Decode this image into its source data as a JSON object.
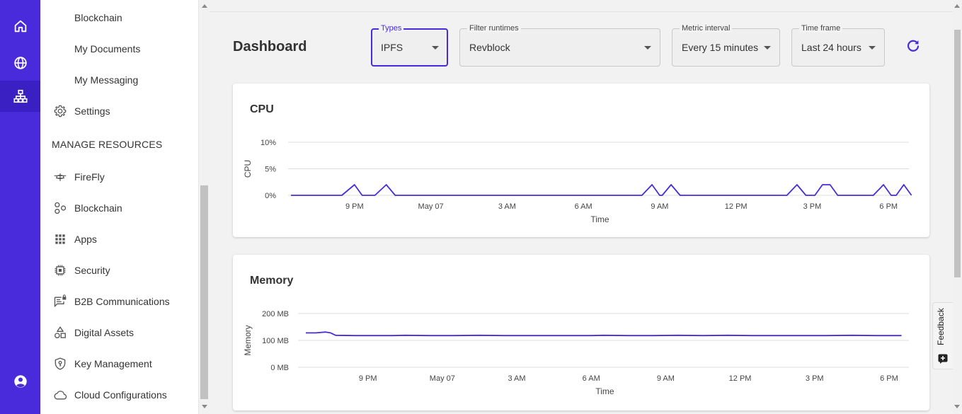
{
  "rail": {
    "items": [
      {
        "icon": "home-icon"
      },
      {
        "icon": "globe-icon"
      },
      {
        "icon": "network-icon"
      }
    ],
    "bottom_icon": "account-icon",
    "colors": {
      "bg": "#4a2bdc",
      "active": "#3a1fc2"
    }
  },
  "sidebar": {
    "sub_items": [
      {
        "label": "Blockchain"
      },
      {
        "label": "My Documents"
      },
      {
        "label": "My Messaging"
      }
    ],
    "settings_label": "Settings",
    "section_heading": "MANAGE RESOURCES",
    "resources": [
      {
        "label": "FireFly",
        "icon": "firefly-icon"
      },
      {
        "label": "Blockchain",
        "icon": "blockchain-icon"
      },
      {
        "label": "Apps",
        "icon": "apps-grid-icon"
      },
      {
        "label": "Security",
        "icon": "chip-icon"
      },
      {
        "label": "B2B Communications",
        "icon": "message-lock-icon"
      },
      {
        "label": "Digital Assets",
        "icon": "shapes-icon"
      },
      {
        "label": "Key Management",
        "icon": "shield-key-icon"
      },
      {
        "label": "Cloud Configurations",
        "icon": "cloud-icon"
      }
    ]
  },
  "header": {
    "title": "Dashboard",
    "filters": {
      "types": {
        "label": "Types",
        "value": "IPFS"
      },
      "runtimes": {
        "label": "Filter runtimes",
        "value": "Revblock"
      },
      "interval": {
        "label": "Metric interval",
        "value": "Every 15 minutes"
      },
      "timeframe": {
        "label": "Time frame",
        "value": "Last 24 hours"
      }
    },
    "refresh_icon": "refresh-icon"
  },
  "feedback": {
    "label": "Feedback"
  },
  "accent_color": "#4a2bdc",
  "chart_data": [
    {
      "type": "line",
      "title": "CPU",
      "xlabel": "Time",
      "ylabel": "CPU",
      "yticks": [
        "0%",
        "5%",
        "10%"
      ],
      "ylim": [
        0,
        10
      ],
      "xticks": [
        {
          "t": 2.5,
          "label": "9 PM"
        },
        {
          "t": 5.5,
          "label": "May 07"
        },
        {
          "t": 8.5,
          "label": "3 AM"
        },
        {
          "t": 11.5,
          "label": "6 AM"
        },
        {
          "t": 14.5,
          "label": "9 AM"
        },
        {
          "t": 17.5,
          "label": "12 PM"
        },
        {
          "t": 20.5,
          "label": "3 PM"
        },
        {
          "t": 23.5,
          "label": "6 PM"
        }
      ],
      "xlim": [
        0,
        24.3
      ],
      "series": [
        {
          "color": "#4a2bdc",
          "points": [
            [
              0,
              0
            ],
            [
              2.0,
              0
            ],
            [
              2.5,
              2
            ],
            [
              2.8,
              0
            ],
            [
              3.3,
              0
            ],
            [
              3.75,
              2
            ],
            [
              4.1,
              0
            ],
            [
              13.8,
              0
            ],
            [
              14.2,
              2
            ],
            [
              14.5,
              0
            ],
            [
              14.6,
              0
            ],
            [
              14.95,
              2
            ],
            [
              15.3,
              0
            ],
            [
              19.5,
              0
            ],
            [
              19.9,
              2
            ],
            [
              20.25,
              0
            ],
            [
              20.6,
              0
            ],
            [
              20.9,
              2
            ],
            [
              21.2,
              2
            ],
            [
              21.5,
              0
            ],
            [
              22.9,
              0
            ],
            [
              23.3,
              2
            ],
            [
              23.6,
              0
            ],
            [
              23.8,
              0
            ],
            [
              24.1,
              2
            ],
            [
              24.4,
              0
            ]
          ]
        }
      ]
    },
    {
      "type": "line",
      "title": "Memory",
      "xlabel": "Time",
      "ylabel": "Memory",
      "yticks": [
        "0 MB",
        "100 MB",
        "200 MB"
      ],
      "ylim": [
        0,
        200
      ],
      "xticks": [
        {
          "t": 2.5,
          "label": "9 PM"
        },
        {
          "t": 5.5,
          "label": "May 07"
        },
        {
          "t": 8.5,
          "label": "3 AM"
        },
        {
          "t": 11.5,
          "label": "6 AM"
        },
        {
          "t": 14.5,
          "label": "9 AM"
        },
        {
          "t": 17.5,
          "label": "12 PM"
        },
        {
          "t": 20.5,
          "label": "3 PM"
        },
        {
          "t": 23.5,
          "label": "6 PM"
        }
      ],
      "xlim": [
        -0.2,
        24.3
      ],
      "series": [
        {
          "color": "#4a2bdc",
          "points": [
            [
              0,
              128
            ],
            [
              0.4,
              128
            ],
            [
              0.8,
              131
            ],
            [
              1.0,
              128
            ],
            [
              1.2,
              119
            ],
            [
              2.0,
              118
            ],
            [
              3.5,
              118
            ],
            [
              4.0,
              119
            ],
            [
              5.0,
              118
            ],
            [
              6.0,
              118
            ],
            [
              7.0,
              119
            ],
            [
              8.0,
              118
            ],
            [
              10.0,
              118
            ],
            [
              11.5,
              118
            ],
            [
              12.0,
              119
            ],
            [
              13.0,
              118
            ],
            [
              14.0,
              118
            ],
            [
              15.0,
              119
            ],
            [
              16.0,
              118
            ],
            [
              17.0,
              119
            ],
            [
              18.0,
              118
            ],
            [
              20.0,
              118
            ],
            [
              21.0,
              118
            ],
            [
              22.0,
              119
            ],
            [
              23.0,
              118
            ],
            [
              24.0,
              118
            ]
          ]
        }
      ]
    }
  ]
}
